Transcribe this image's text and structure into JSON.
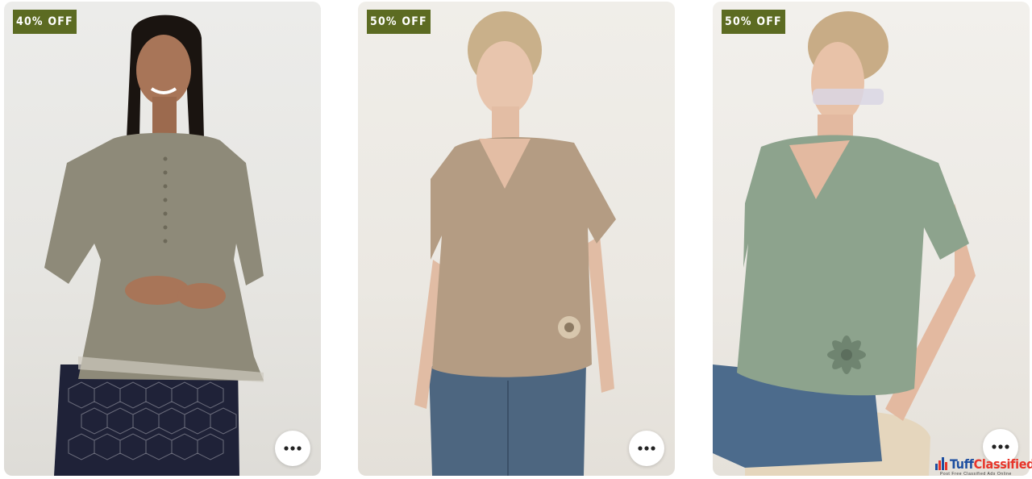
{
  "products": [
    {
      "badge": "40% OFF",
      "image": "model-in-olive-grey-peplum-top"
    },
    {
      "badge": "50% OFF",
      "image": "model-in-beige-v-neck-top"
    },
    {
      "badge": "50% OFF",
      "image": "model-in-sage-green-v-neck-top"
    }
  ],
  "more_icon": "more-horizontal-icon",
  "watermark": {
    "name_a": "Tuff",
    "name_b": "Classified",
    "tagline": "Post Free Classified Ads Online"
  },
  "colors": {
    "badge_bg": "#5c6b22",
    "badge_text": "#ffffff",
    "watermark_blue": "#1d4ea0",
    "watermark_red": "#e8352a"
  }
}
